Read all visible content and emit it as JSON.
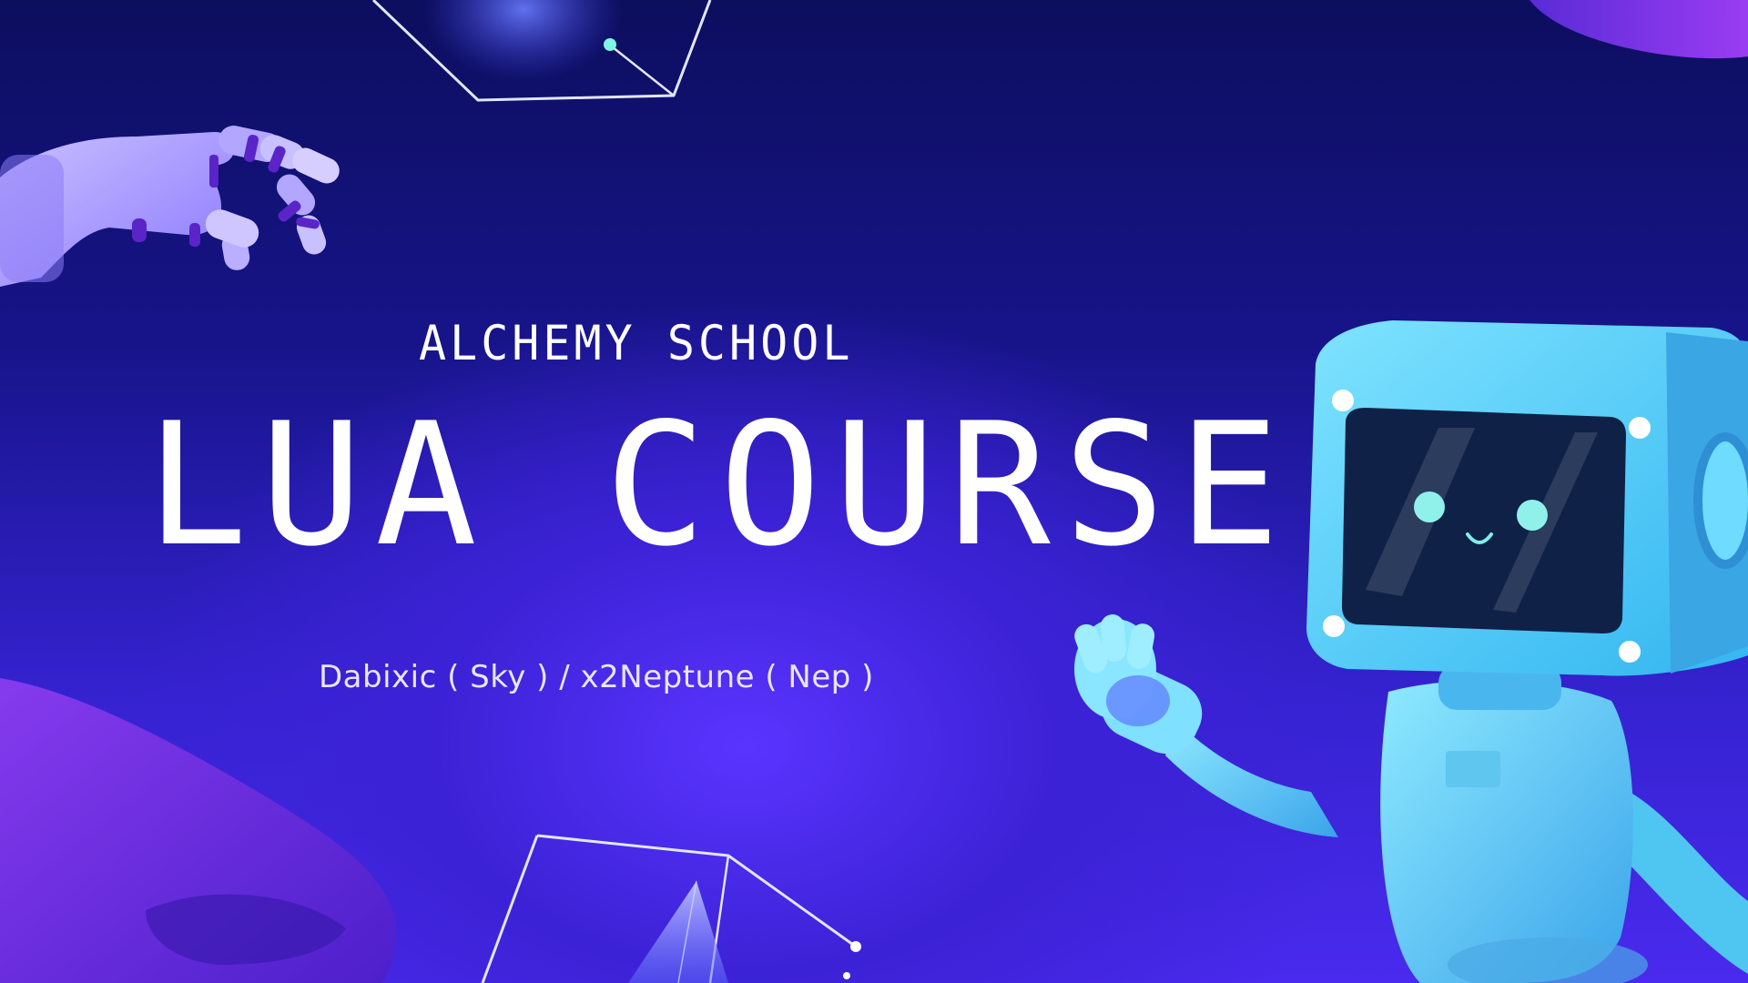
{
  "slide": {
    "kicker": "ALCHEMY SCHOOL",
    "title": "LUA COURSE",
    "authors": "Dabixic ( Sky ) / x2Neptune ( Nep )"
  },
  "illustrations": {
    "hand": "robot-hand-icon",
    "robot": "robot-mascot-icon",
    "cubes": "wireframe-cube-icon"
  },
  "colors": {
    "background_top": "#0c0e5e",
    "background_bottom": "#4a2aee",
    "robot_body": "#5fd8ff",
    "hand": "#a99bff",
    "text": "#ffffff"
  }
}
